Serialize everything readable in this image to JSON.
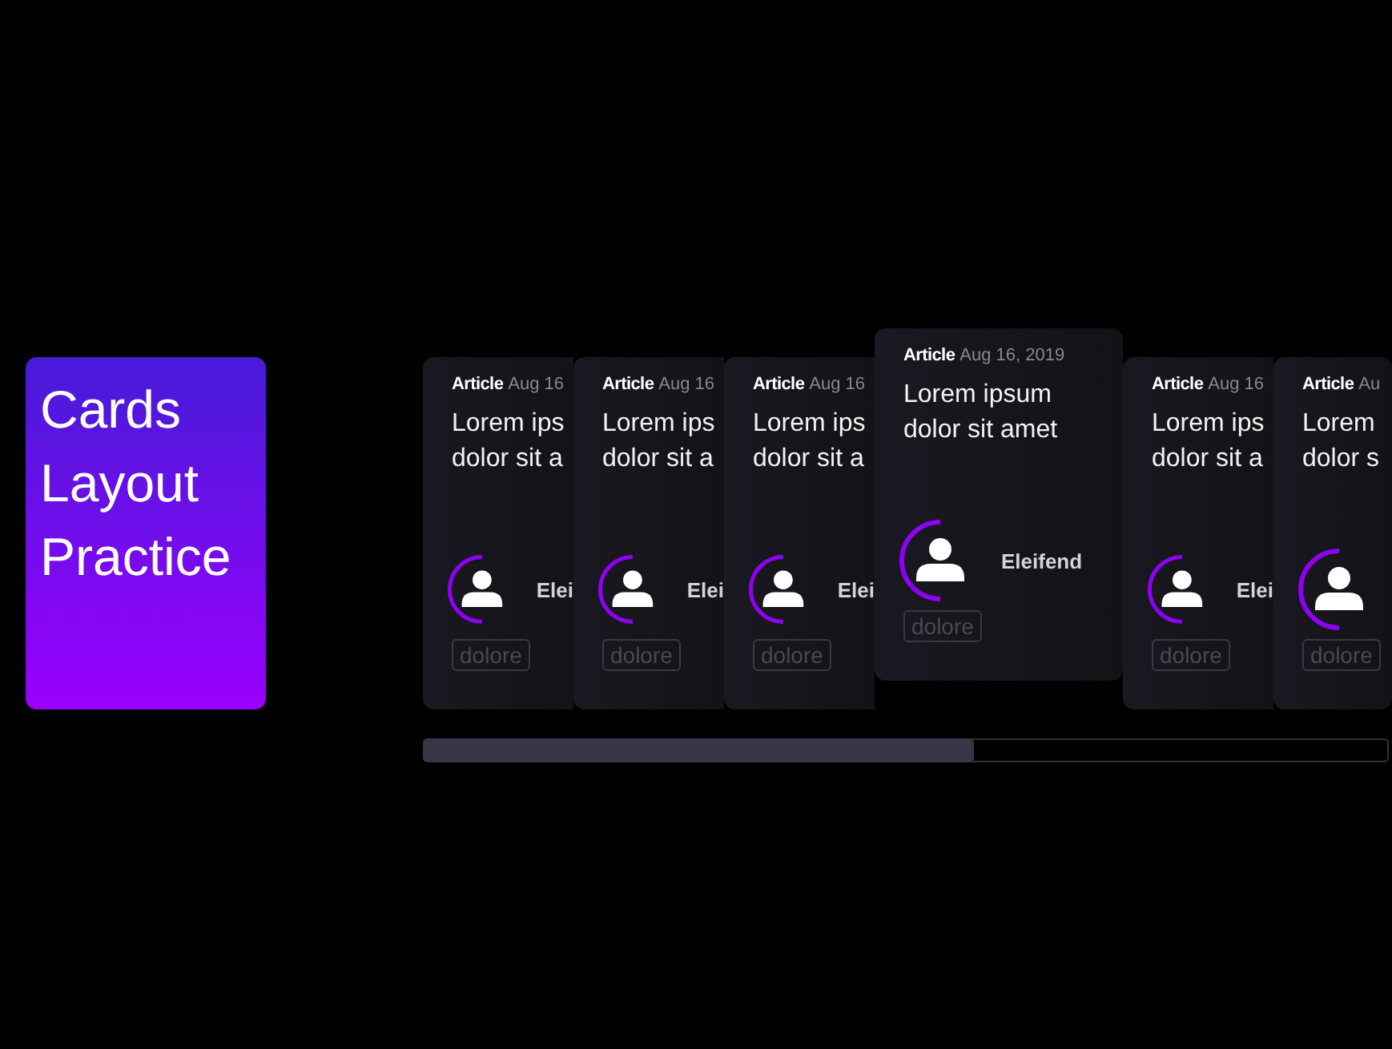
{
  "hero": {
    "title_lines": [
      "Cards",
      "Layout",
      "Practice"
    ]
  },
  "cards": [
    {
      "kind": "Article",
      "date": "Aug 16",
      "title_lines": [
        "Lorem ips",
        "dolor sit a"
      ],
      "author": "Elei",
      "tag": "dolore",
      "raised": false
    },
    {
      "kind": "Article",
      "date": "Aug 16",
      "title_lines": [
        "Lorem ips",
        "dolor sit a"
      ],
      "author": "Elei",
      "tag": "dolore",
      "raised": false
    },
    {
      "kind": "Article",
      "date": "Aug 16",
      "title_lines": [
        "Lorem ips",
        "dolor sit a"
      ],
      "author": "Elei",
      "tag": "dolore",
      "raised": false
    },
    {
      "kind": "Article",
      "date": "Aug 16, 2019",
      "title_lines": [
        "Lorem ipsum",
        "dolor sit amet"
      ],
      "author": "Eleifend",
      "tag": "dolore",
      "raised": true
    },
    {
      "kind": "Article",
      "date": "Aug 16",
      "title_lines": [
        "Lorem ips",
        "dolor sit a"
      ],
      "author": "Elei",
      "tag": "dolore",
      "raised": false
    },
    {
      "kind": "Article",
      "date": "Au",
      "title_lines": [
        "Lorem",
        "dolor s"
      ],
      "tag": "dolore",
      "raised": false
    }
  ]
}
